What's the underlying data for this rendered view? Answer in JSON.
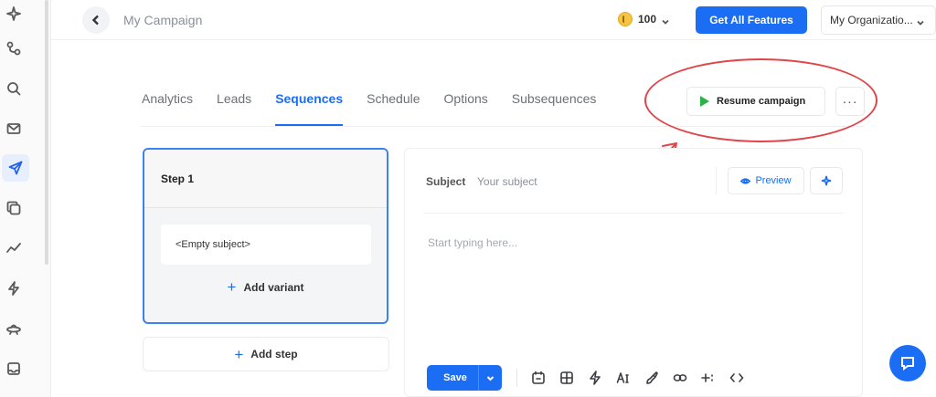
{
  "header": {
    "title": "My Campaign",
    "credits": "100",
    "get_features_label": "Get All Features",
    "organization": "My Organizatio..."
  },
  "sidebar": {
    "items": [
      {
        "icon": "sparkle-icon"
      },
      {
        "icon": "workflow-icon"
      },
      {
        "icon": "search-icon"
      },
      {
        "icon": "mail-icon"
      },
      {
        "icon": "send-icon",
        "active": true
      },
      {
        "icon": "copy-icon"
      },
      {
        "icon": "analytics-icon"
      },
      {
        "icon": "bolt-icon"
      },
      {
        "icon": "ufo-icon"
      },
      {
        "icon": "inbox-icon"
      }
    ]
  },
  "tabs": [
    {
      "label": "Analytics"
    },
    {
      "label": "Leads"
    },
    {
      "label": "Sequences",
      "active": true
    },
    {
      "label": "Schedule"
    },
    {
      "label": "Options"
    },
    {
      "label": "Subsequences"
    }
  ],
  "actions": {
    "resume_label": "Resume campaign",
    "more_label": "···"
  },
  "steps": {
    "step_title": "Step 1",
    "variant_subject": "<Empty subject>",
    "add_variant_label": "Add variant",
    "add_step_label": "Add step"
  },
  "editor": {
    "subject_label": "Subject",
    "subject_placeholder": "Your subject",
    "preview_label": "Preview",
    "body_placeholder": "Start typing here...",
    "save_label": "Save",
    "toolbar_icons": [
      "calendar-icon",
      "template-icon",
      "lightning-icon",
      "text-format-icon",
      "paint-icon",
      "link-icon",
      "variable-icon",
      "code-icon"
    ]
  },
  "colors": {
    "accent": "#1b6ef3",
    "play": "#2bb24c",
    "annotation": "#e0454a"
  }
}
